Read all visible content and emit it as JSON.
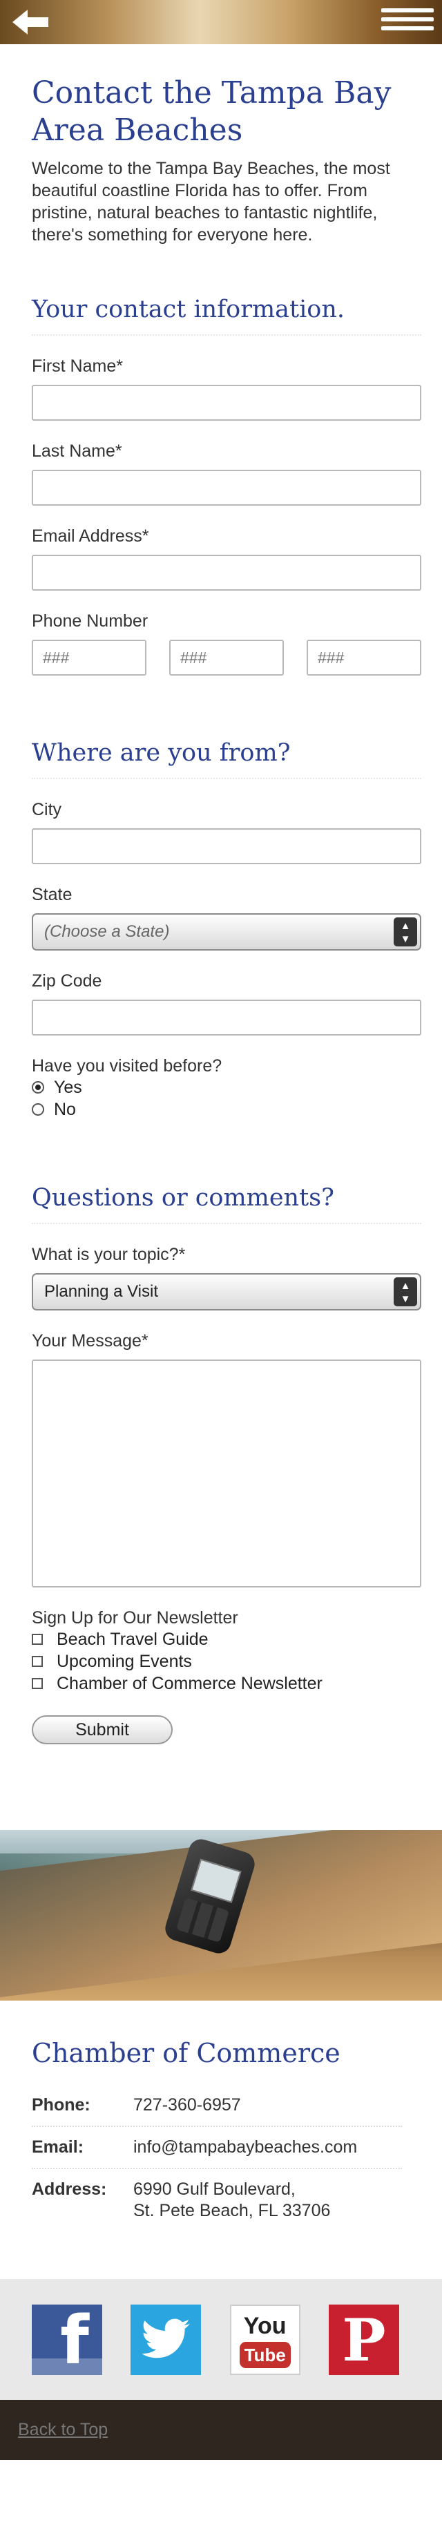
{
  "header": {
    "back_icon": "back-arrow-icon",
    "menu_icon": "hamburger-menu-icon"
  },
  "page": {
    "title": "Contact the Tampa Bay Area Beaches",
    "intro": "Welcome to the Tampa Bay Beaches, the most beautiful coastline Florida has to offer. From pristine, natural beaches to fantastic nightlife, there's something for everyone here."
  },
  "contact_info": {
    "heading": "Your contact information.",
    "first_name_label": "First Name*",
    "last_name_label": "Last Name*",
    "email_label": "Email Address*",
    "phone_label": "Phone Number",
    "phone_placeholders": [
      "###",
      "###",
      "###"
    ]
  },
  "location": {
    "heading": "Where are you from?",
    "city_label": "City",
    "state_label": "State",
    "state_value": "(Choose a State)",
    "zip_label": "Zip Code",
    "visited_label": "Have you visited before?",
    "visited_options": [
      "Yes",
      "No"
    ],
    "visited_selected": "Yes"
  },
  "questions": {
    "heading": "Questions or comments?",
    "topic_label": "What is your topic?*",
    "topic_value": "Planning a Visit",
    "message_label": "Your Message*",
    "newsletter_label": "Sign Up for Our Newsletter",
    "newsletter_options": [
      "Beach Travel Guide",
      "Upcoming Events",
      "Chamber of Commerce Newsletter"
    ],
    "submit_label": "Submit"
  },
  "chamber": {
    "heading": "Chamber of Commerce",
    "phone_key": "Phone:",
    "phone_value": "727-360-6957",
    "email_key": "Email:",
    "email_value": "info@tampabaybeaches.com",
    "address_key": "Address:",
    "address_line1": "6990 Gulf Boulevard,",
    "address_line2": "St. Pete Beach, FL 33706"
  },
  "social": {
    "facebook_letter": "f",
    "youtube_top": "You",
    "youtube_bottom": "Tube",
    "pinterest_letter": "P",
    "icons": [
      "facebook-icon",
      "twitter-icon",
      "youtube-icon",
      "pinterest-icon"
    ]
  },
  "footer": {
    "back_to_top": "Back to Top"
  },
  "colors": {
    "heading": "#2a3f8f",
    "footer_bg": "#2f2620",
    "facebook": "#3b5998",
    "twitter": "#2aa5e0",
    "pinterest": "#c8202e"
  }
}
